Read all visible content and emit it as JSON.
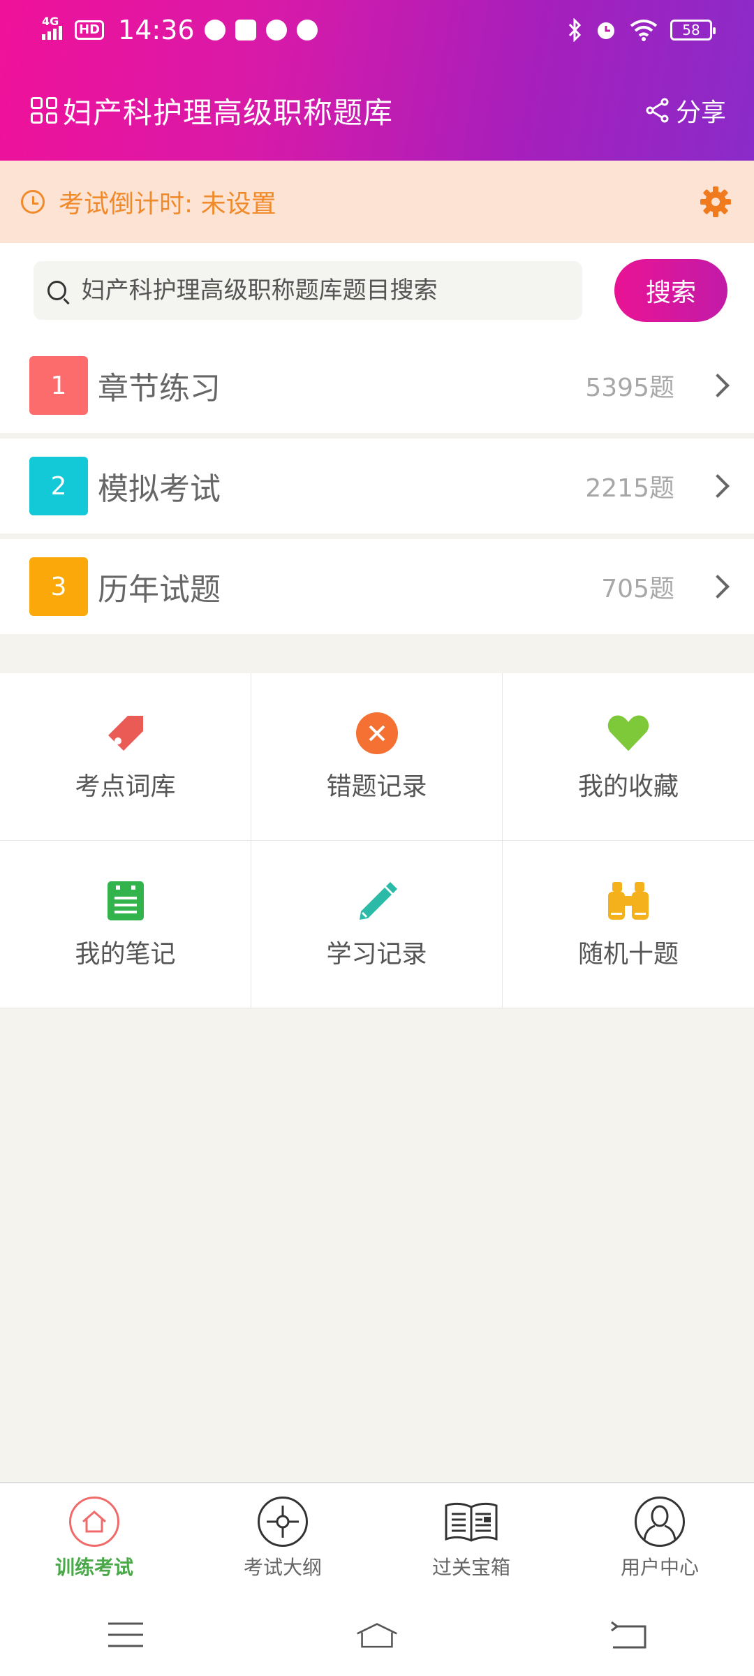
{
  "status": {
    "network": "4G",
    "hd": "HD",
    "time": "14:36",
    "battery": "58"
  },
  "header": {
    "title": "妇产科护理高级职称题库",
    "share_label": "分享"
  },
  "countdown": {
    "text": "考试倒计时: 未设置"
  },
  "search": {
    "placeholder": "妇产科护理高级职称题库题目搜索",
    "button_label": "搜索"
  },
  "list": [
    {
      "num": "1",
      "title": "章节练习",
      "count": "5395题",
      "color": "#fd6c6c"
    },
    {
      "num": "2",
      "title": "模拟考试",
      "count": "2215题",
      "color": "#13c8d7"
    },
    {
      "num": "3",
      "title": "历年试题",
      "count": "705题",
      "color": "#fba90a"
    }
  ],
  "tools": [
    {
      "label": "考点词库",
      "icon": "tag-icon",
      "color": "#ea5b56"
    },
    {
      "label": "错题记录",
      "icon": "close-circle-icon",
      "color": "#f47133"
    },
    {
      "label": "我的收藏",
      "icon": "heart-icon",
      "color": "#7ec93a"
    },
    {
      "label": "我的笔记",
      "icon": "note-icon",
      "color": "#32b34c"
    },
    {
      "label": "学习记录",
      "icon": "pencil-icon",
      "color": "#2cbaa8"
    },
    {
      "label": "随机十题",
      "icon": "binoculars-icon",
      "color": "#f5b11b"
    }
  ],
  "bottom_nav": [
    {
      "label": "训练考试",
      "icon": "home-icon",
      "active": true
    },
    {
      "label": "考试大纲",
      "icon": "target-icon",
      "active": false
    },
    {
      "label": "过关宝箱",
      "icon": "newspaper-icon",
      "active": false
    },
    {
      "label": "用户中心",
      "icon": "user-icon",
      "active": false
    }
  ],
  "colors": {
    "accent_orange": "#f08a2a",
    "active_green": "#4aa84a",
    "header_start": "#f0119a",
    "header_end": "#8a2bc9"
  }
}
